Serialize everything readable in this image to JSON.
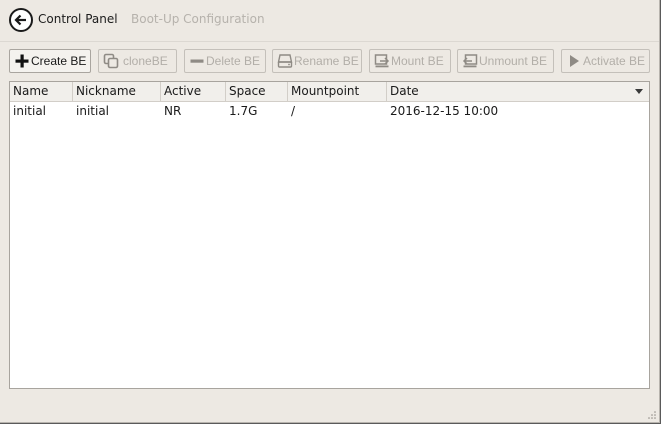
{
  "header": {
    "breadcrumb_current": "Control Panel",
    "breadcrumb_next": "Boot-Up Configuration"
  },
  "toolbar": {
    "buttons": [
      {
        "label": "Create BE",
        "icon": "plus-icon",
        "enabled": true
      },
      {
        "label": "cloneBE",
        "icon": "clone-icon",
        "enabled": false
      },
      {
        "label": "Delete BE",
        "icon": "minus-icon",
        "enabled": false
      },
      {
        "label": "Rename BE",
        "icon": "drive-icon",
        "enabled": false
      },
      {
        "label": "Mount BE",
        "icon": "mount-icon",
        "enabled": false
      },
      {
        "label": "Unmount BE",
        "icon": "unmount-icon",
        "enabled": false
      },
      {
        "label": "Activate BE",
        "icon": "play-icon",
        "enabled": false
      }
    ]
  },
  "table": {
    "columns": [
      "Name",
      "Nickname",
      "Active",
      "Space",
      "Mountpoint",
      "Date"
    ],
    "rows": [
      [
        "initial",
        "initial",
        "NR",
        "1.7G",
        "/",
        "2016-12-15 10:00"
      ]
    ]
  },
  "colors": {
    "window_bg": "#ede9e3",
    "disabled_text": "#b2aea8",
    "text": "#1a1a1a"
  }
}
